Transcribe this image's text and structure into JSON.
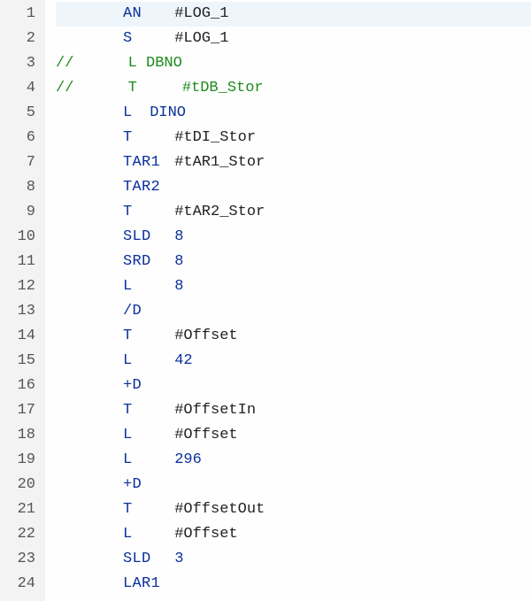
{
  "lines": [
    {
      "n": 1,
      "comment": false,
      "op": "AN",
      "operand": "#LOG_1",
      "opClass": "operand",
      "highlight": true
    },
    {
      "n": 2,
      "comment": false,
      "op": "S",
      "operand": "#LOG_1",
      "opClass": "operand"
    },
    {
      "n": 3,
      "comment": true,
      "text": "//      L DBNO"
    },
    {
      "n": 4,
      "comment": true,
      "text": "//      T     #tDB_Stor"
    },
    {
      "n": 5,
      "comment": false,
      "op": "L",
      "operand": "DINO",
      "opClass": "blue",
      "tight": true
    },
    {
      "n": 6,
      "comment": false,
      "op": "T",
      "operand": "#tDI_Stor",
      "opClass": "operand"
    },
    {
      "n": 7,
      "comment": false,
      "op": "TAR1",
      "operand": "#tAR1_Stor",
      "opClass": "operand"
    },
    {
      "n": 8,
      "comment": false,
      "op": "TAR2",
      "operand": "",
      "opClass": "operand"
    },
    {
      "n": 9,
      "comment": false,
      "op": "T",
      "operand": "#tAR2_Stor",
      "opClass": "operand"
    },
    {
      "n": 10,
      "comment": false,
      "op": "SLD",
      "operand": "8",
      "opClass": "num"
    },
    {
      "n": 11,
      "comment": false,
      "op": "SRD",
      "operand": "8",
      "opClass": "num"
    },
    {
      "n": 12,
      "comment": false,
      "op": "L",
      "operand": "8",
      "opClass": "num"
    },
    {
      "n": 13,
      "comment": false,
      "op": "/D",
      "operand": "",
      "opClass": "operand"
    },
    {
      "n": 14,
      "comment": false,
      "op": "T",
      "operand": "#Offset",
      "opClass": "operand"
    },
    {
      "n": 15,
      "comment": false,
      "op": "L",
      "operand": "42",
      "opClass": "num"
    },
    {
      "n": 16,
      "comment": false,
      "op": "+D",
      "operand": "",
      "opClass": "operand"
    },
    {
      "n": 17,
      "comment": false,
      "op": "T",
      "operand": "#OffsetIn",
      "opClass": "operand"
    },
    {
      "n": 18,
      "comment": false,
      "op": "L",
      "operand": "#Offset",
      "opClass": "operand"
    },
    {
      "n": 19,
      "comment": false,
      "op": "L",
      "operand": "296",
      "opClass": "num"
    },
    {
      "n": 20,
      "comment": false,
      "op": "+D",
      "operand": "",
      "opClass": "operand"
    },
    {
      "n": 21,
      "comment": false,
      "op": "T",
      "operand": "#OffsetOut",
      "opClass": "operand"
    },
    {
      "n": 22,
      "comment": false,
      "op": "L",
      "operand": "#Offset",
      "opClass": "operand"
    },
    {
      "n": 23,
      "comment": false,
      "op": "SLD",
      "operand": "3",
      "opClass": "num"
    },
    {
      "n": 24,
      "comment": false,
      "op": "LAR1",
      "operand": "",
      "opClass": "operand"
    }
  ]
}
